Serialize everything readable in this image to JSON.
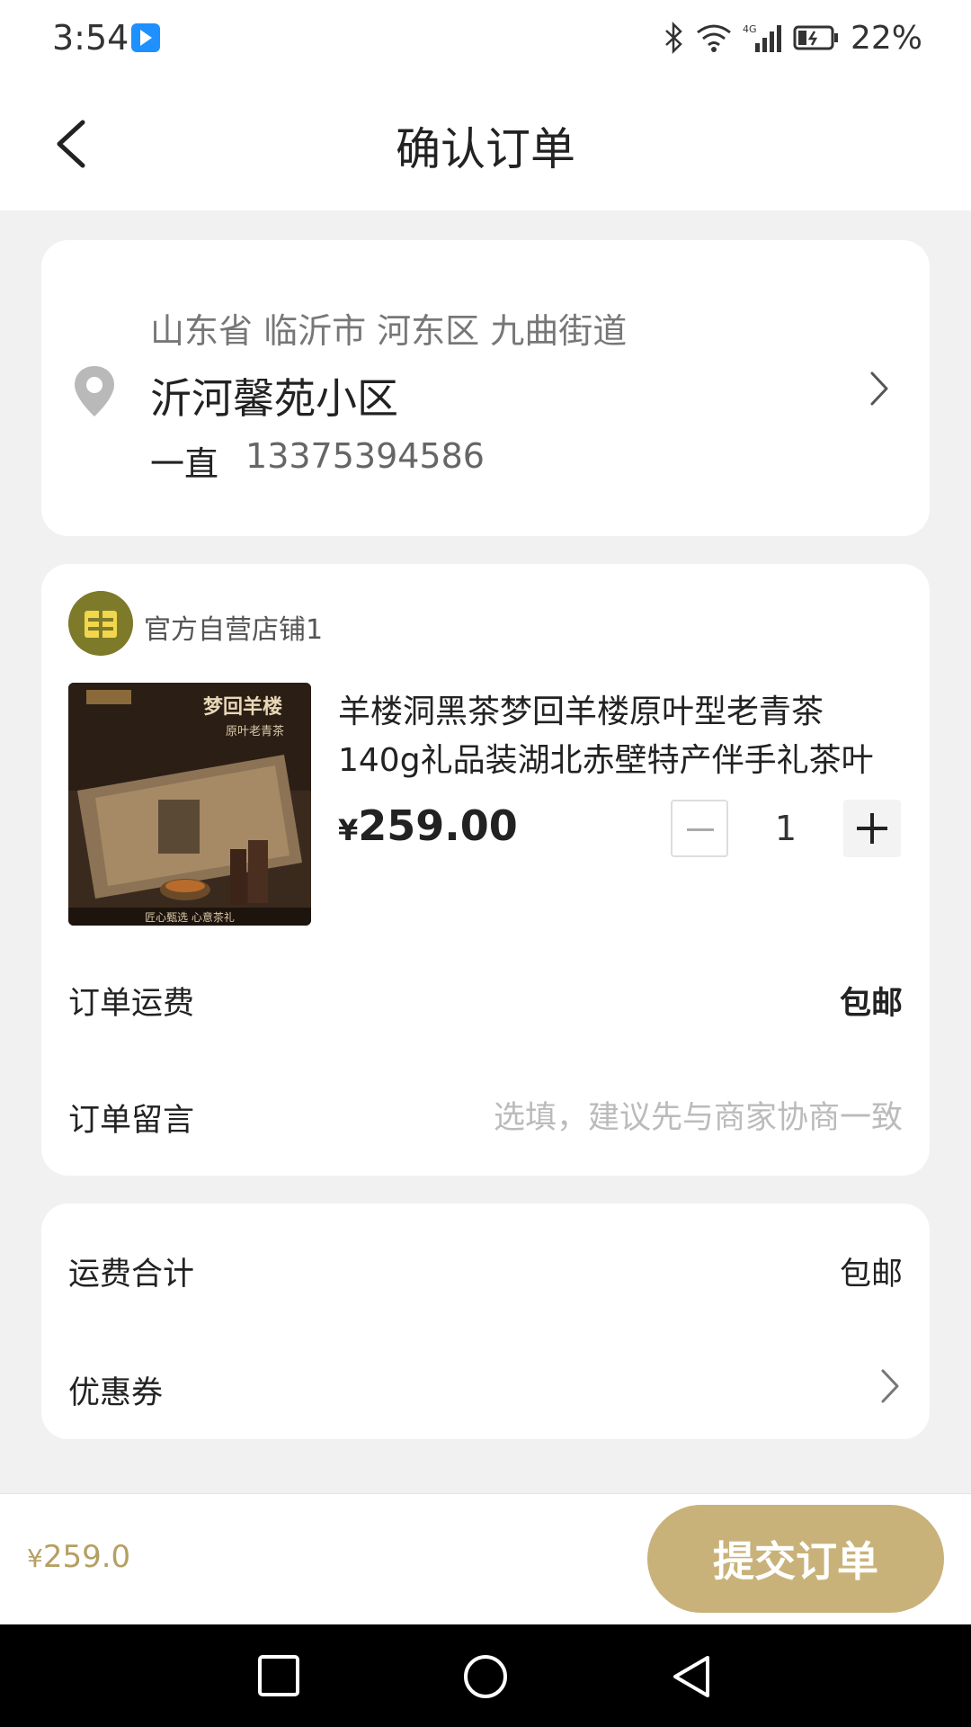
{
  "status_bar": {
    "time": "3:54",
    "battery_pct": "22%"
  },
  "header": {
    "title": "确认订单"
  },
  "address": {
    "region": "山东省 临沂市 河东区 九曲街道",
    "detail": "沂河馨苑小区",
    "name": "一直",
    "phone": "13375394586"
  },
  "shop": {
    "name": "官方自营店铺1"
  },
  "product": {
    "title": "羊楼洞黑茶梦回羊楼原叶型老青茶140g礼品装湖北赤壁特产伴手礼茶叶",
    "image_text_main": "梦回羊楼",
    "image_text_sub": "原叶老青茶",
    "image_caption": "匠心甄选    心意茶礼",
    "currency": "¥",
    "price": "259.00",
    "quantity": "1"
  },
  "order": {
    "shipping_label": "订单运费",
    "shipping_value": "包邮",
    "note_label": "订单留言",
    "note_placeholder": "选填，建议先与商家协商一致",
    "note_value": ""
  },
  "summary": {
    "freight_label": "运费合计",
    "freight_value": "包邮",
    "coupon_label": "优惠券"
  },
  "bottom": {
    "currency": "¥",
    "total": "259.0",
    "submit_label": "提交订单"
  },
  "colors": {
    "accent": "#c9b27a",
    "price_gold": "#b59f62",
    "background": "#f1f1f1"
  }
}
